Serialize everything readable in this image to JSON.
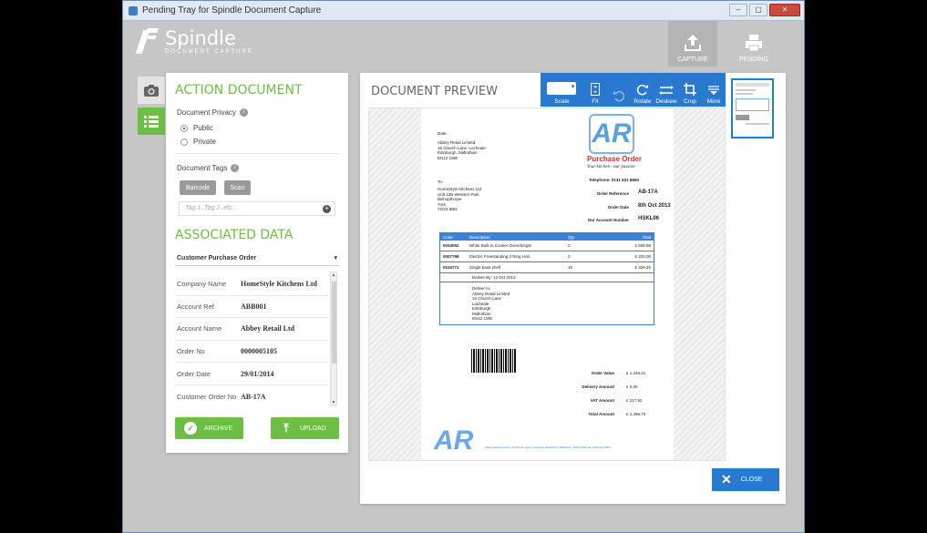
{
  "window": {
    "title": "Pending Tray for Spindle Document Capture",
    "buttons": [
      "–",
      "▢",
      "✕"
    ]
  },
  "logo": {
    "name": "Spindle",
    "subtitle": "DOCUMENT CAPTURE"
  },
  "nav": {
    "capture": "CAPTURE",
    "pending": "PENDING"
  },
  "action": {
    "title": "ACTION DOCUMENT",
    "privacy_label": "Document Privacy",
    "options": [
      "Public",
      "Private"
    ],
    "selected": "Public",
    "tags_label": "Document Tags",
    "tag_buttons": [
      "Barcode",
      "Scan"
    ],
    "tag_placeholder": "Tag 1, Tag 2, etc..."
  },
  "associated": {
    "title": "ASSOCIATED DATA",
    "selected_type": "Customer Purchase Order",
    "rows": [
      {
        "key": "Company Name",
        "value": "HomeStyle Kitchens Ltd"
      },
      {
        "key": "Account Ref",
        "value": "ABB001"
      },
      {
        "key": "Account Name",
        "value": "Abbey Retail Ltd"
      },
      {
        "key": "Order No",
        "value": "0000005105"
      },
      {
        "key": "Order Date",
        "value": "29/01/2014"
      },
      {
        "key": "Customer Order No",
        "value": "AB-17A"
      }
    ],
    "archive_label": "ARCHIVE",
    "upload_label": "UPLOAD"
  },
  "preview": {
    "title": "DOCUMENT PREVIEW",
    "toolbar": [
      "Scale",
      "Fit",
      "Rotate",
      "Deskew",
      "Crop",
      "More"
    ],
    "close_label": "CLOSE"
  },
  "document": {
    "logo_letters": "AR",
    "heading": "Purchase Order",
    "tagline": "Your kitchen - our passion",
    "telephone": "Telephone: 0131 621 8660",
    "date_label": "Date:",
    "from_lines": [
      "Abbey Retail Limited",
      "16 Church Lane, Locheale",
      "Edinburgh, Midlothian",
      "EN12 1WE"
    ],
    "to_label": "To:",
    "to_lines": [
      "HomeStyle Kitchens Ltd",
      "Unit 12B Western Park",
      "Bishopthorpe",
      "York",
      "YO23 6BG"
    ],
    "meta": [
      {
        "label": "Order Reference",
        "value": "AB-17A"
      },
      {
        "label": "Order Date",
        "value": "8th Oct 2013"
      },
      {
        "label": "Our Account Number",
        "value": "HSKL06"
      }
    ],
    "table_headers": [
      "Code",
      "Description",
      "Qty",
      "Total"
    ],
    "items": [
      {
        "code": "0034052",
        "desc": "White Built-in Cooker Oven/Single",
        "qty": "2",
        "total": "£ 599.98"
      },
      {
        "code": "0007798",
        "desc": "Electric Freestanding 3 Ring Hob",
        "qty": "2",
        "total": "£ 320.00"
      },
      {
        "code": "0016771",
        "desc": "Single base shelf",
        "qty": "15",
        "total": "£ 329.25"
      }
    ],
    "deliver_by": "Deliver By: 12 Oct 2013",
    "deliver_to": [
      "Deliver to:",
      "Abbey Retail Limited",
      "16 Church Lane",
      "Locheale",
      "Edinburgh",
      "Midlothian",
      "EN12 1WE"
    ],
    "totals": [
      {
        "label": "Order Value",
        "value": "£ 1,249.21"
      },
      {
        "label": "Delivery Amount",
        "value": "£ 0.00"
      },
      {
        "label": "VAT Amount",
        "value": "£ 217.52"
      },
      {
        "label": "Total Amount",
        "value": "£ 1,466.73"
      }
    ],
    "footer": "Abbey Retail Limited, 16 Church Lane, Locheale, Edinburgh, Midlothian, EN12 1WE Tel: 0131 621 8660"
  }
}
